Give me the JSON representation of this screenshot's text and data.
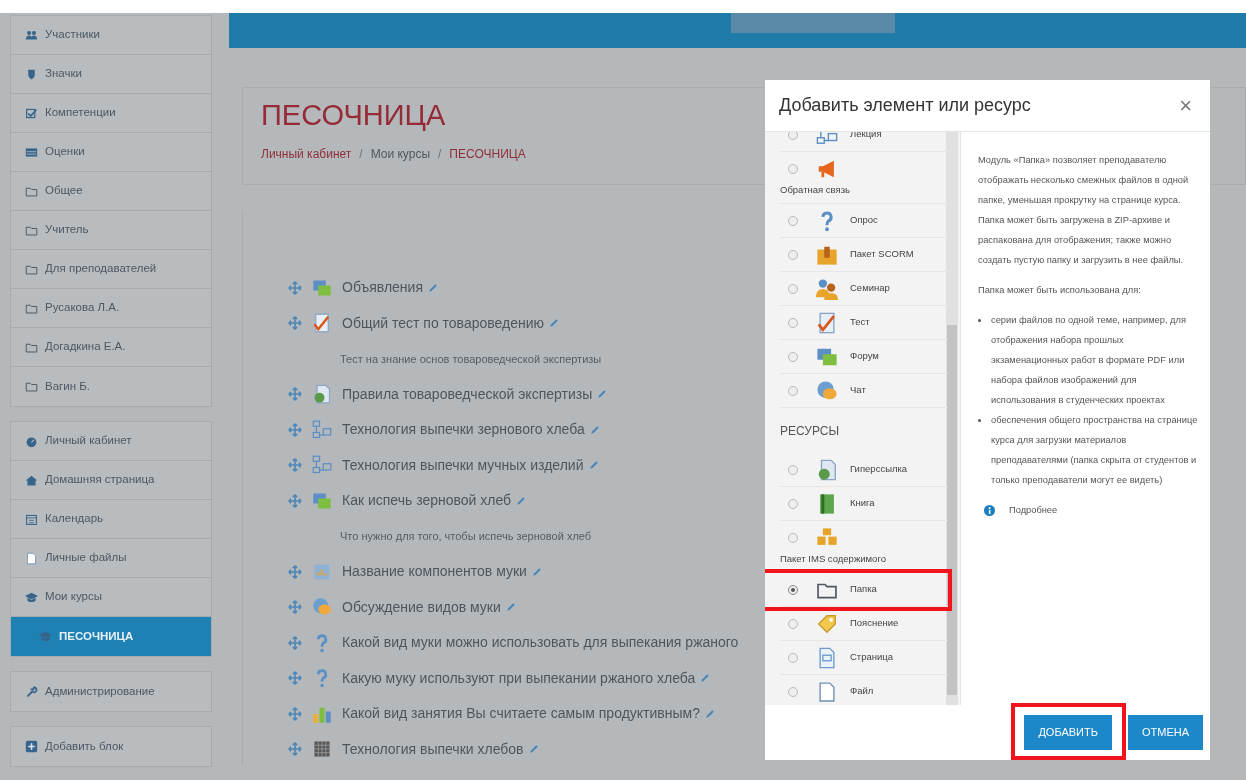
{
  "sidebar": {
    "groups": [
      [
        {
          "label": "Участники",
          "kind": "users",
          "selected": false
        },
        {
          "label": "Значки",
          "kind": "badge",
          "selected": false
        },
        {
          "label": "Компетенции",
          "kind": "check",
          "selected": false
        },
        {
          "label": "Оценки",
          "kind": "table",
          "selected": false
        },
        {
          "label": "Общее",
          "kind": "folder",
          "selected": false
        },
        {
          "label": "Учитель",
          "kind": "folder",
          "selected": false
        },
        {
          "label": "Для преподавателей",
          "kind": "folder",
          "selected": false
        },
        {
          "label": "Русакова Л.А.",
          "kind": "folder",
          "selected": false
        },
        {
          "label": "Догадкина Е.А.",
          "kind": "folder",
          "selected": false
        },
        {
          "label": "Вагин Б.",
          "kind": "folder",
          "selected": false
        }
      ],
      [
        {
          "label": "Личный кабинет",
          "kind": "gauge",
          "selected": false
        },
        {
          "label": "Домашняя страница",
          "kind": "home",
          "selected": false
        },
        {
          "label": "Календарь",
          "kind": "calendar",
          "selected": false
        },
        {
          "label": "Личные файлы",
          "kind": "file",
          "selected": false
        },
        {
          "label": "Мои курсы",
          "kind": "cap",
          "selected": false,
          "children": [
            {
              "label": "ПЕСОЧНИЦА",
              "kind": "cap",
              "selected": true
            }
          ]
        }
      ],
      [
        {
          "label": "Администрирование",
          "kind": "wrench",
          "selected": false
        }
      ],
      [
        {
          "label": "Добавить блок",
          "kind": "plus",
          "selected": false
        }
      ]
    ]
  },
  "course": {
    "title": "ПЕСОЧНИЦА",
    "breadcrumb": [
      {
        "kind": "link",
        "label": "Личный кабинет"
      },
      {
        "kind": "separator",
        "label": "/"
      },
      {
        "kind": "plain",
        "label": "Мои курсы"
      },
      {
        "kind": "separator",
        "label": "/"
      },
      {
        "kind": "current",
        "label": "ПЕСОЧНИЦА"
      }
    ],
    "activities": [
      {
        "kind": "forum",
        "title": "Объявления",
        "pencil": true
      },
      {
        "kind": "quiz",
        "title": "Общий тест по товароведению",
        "pencil": true,
        "description": "Тест на знание основ товароведческой экспертизы"
      },
      {
        "kind": "resource",
        "title": "Правила товароведческой экспертизы",
        "pencil": true
      },
      {
        "kind": "lesson",
        "title": "Технология выпечки зернового хлеба",
        "pencil": true
      },
      {
        "kind": "lesson",
        "title": "Технология выпечки мучных изделий",
        "pencil": true
      },
      {
        "kind": "forum",
        "title": "Как испечь зерновой хлеб",
        "pencil": true,
        "description": "Что нужно для того, чтобы испечь зерновой хлеб"
      },
      {
        "kind": "glossary",
        "title": "Название компонентов муки",
        "pencil": true
      },
      {
        "kind": "chat",
        "title": "Обсуждение видов муки",
        "pencil": true
      },
      {
        "kind": "question",
        "title": "Какой вид муки можно использовать для выпекания ржаного",
        "pencil": false
      },
      {
        "kind": "question",
        "title": "Какую муку используют при выпекании ржаного хлеба",
        "pencil": true
      },
      {
        "kind": "chart",
        "title": "Какой вид занятия Вы считаете самым продуктивным?",
        "pencil": true
      },
      {
        "kind": "grid",
        "title": "Технология выпечки хлебов",
        "pencil": true
      }
    ]
  },
  "modal": {
    "title": "Добавить элемент или ресурс",
    "close": "×",
    "activities": [
      {
        "kind": "row",
        "label": "Лекция",
        "selected": false,
        "highlighted": false
      },
      {
        "kind": "stacked",
        "label": "Обратная связь",
        "selected": false,
        "highlighted": false
      },
      {
        "kind": "row",
        "label": "Опрос",
        "selected": false,
        "highlighted": false
      },
      {
        "kind": "row",
        "label": "Пакет SCORM",
        "selected": false,
        "highlighted": false
      },
      {
        "kind": "row",
        "label": "Семинар",
        "selected": false,
        "highlighted": false
      },
      {
        "kind": "row",
        "label": "Тест",
        "selected": false,
        "highlighted": false
      },
      {
        "kind": "row",
        "label": "Форум",
        "selected": false,
        "highlighted": false
      },
      {
        "kind": "row",
        "label": "Чат",
        "selected": false,
        "highlighted": false
      }
    ],
    "resources_heading": "РЕСУРСЫ",
    "resources": [
      {
        "kind": "row",
        "label": "Гиперссылка",
        "selected": false,
        "highlighted": false
      },
      {
        "kind": "row",
        "label": "Книга",
        "selected": false,
        "highlighted": false
      },
      {
        "kind": "stacked",
        "label": "Пакет IMS содержимого",
        "selected": false,
        "highlighted": false
      },
      {
        "kind": "row",
        "label": "Папка",
        "selected": true,
        "highlighted": true
      },
      {
        "kind": "row",
        "label": "Пояснение",
        "selected": false,
        "highlighted": false
      },
      {
        "kind": "row",
        "label": "Страница",
        "selected": false,
        "highlighted": false
      },
      {
        "kind": "row",
        "label": "Файл",
        "selected": false,
        "highlighted": false
      }
    ],
    "help": {
      "paragraphs": [
        "Модуль «Папка» позволяет преподавателю отображать несколько смежных файлов в одной папке, уменьшая прокрутку на странице курса. Папка может быть загружена в ZIP-архиве и распакована для отображения; также можно создать пустую папку и загрузить в нее файлы.",
        "Папка может быть использована для:"
      ],
      "bullets": [
        "серии файлов по одной теме, например, для отображения набора прошлых экзаменационных работ в формате PDF или набора файлов изображений для использования в студенческих проектах",
        "обеспечения общего пространства на странице курса для загрузки материалов преподавателями (папка скрыта от студентов и только преподаватели могут ее видеть)"
      ],
      "link": "Подробнее"
    },
    "buttons": [
      {
        "label": "ДОБАВИТЬ",
        "highlighted": true
      },
      {
        "label": "ОТМЕНА",
        "highlighted": false
      }
    ]
  }
}
